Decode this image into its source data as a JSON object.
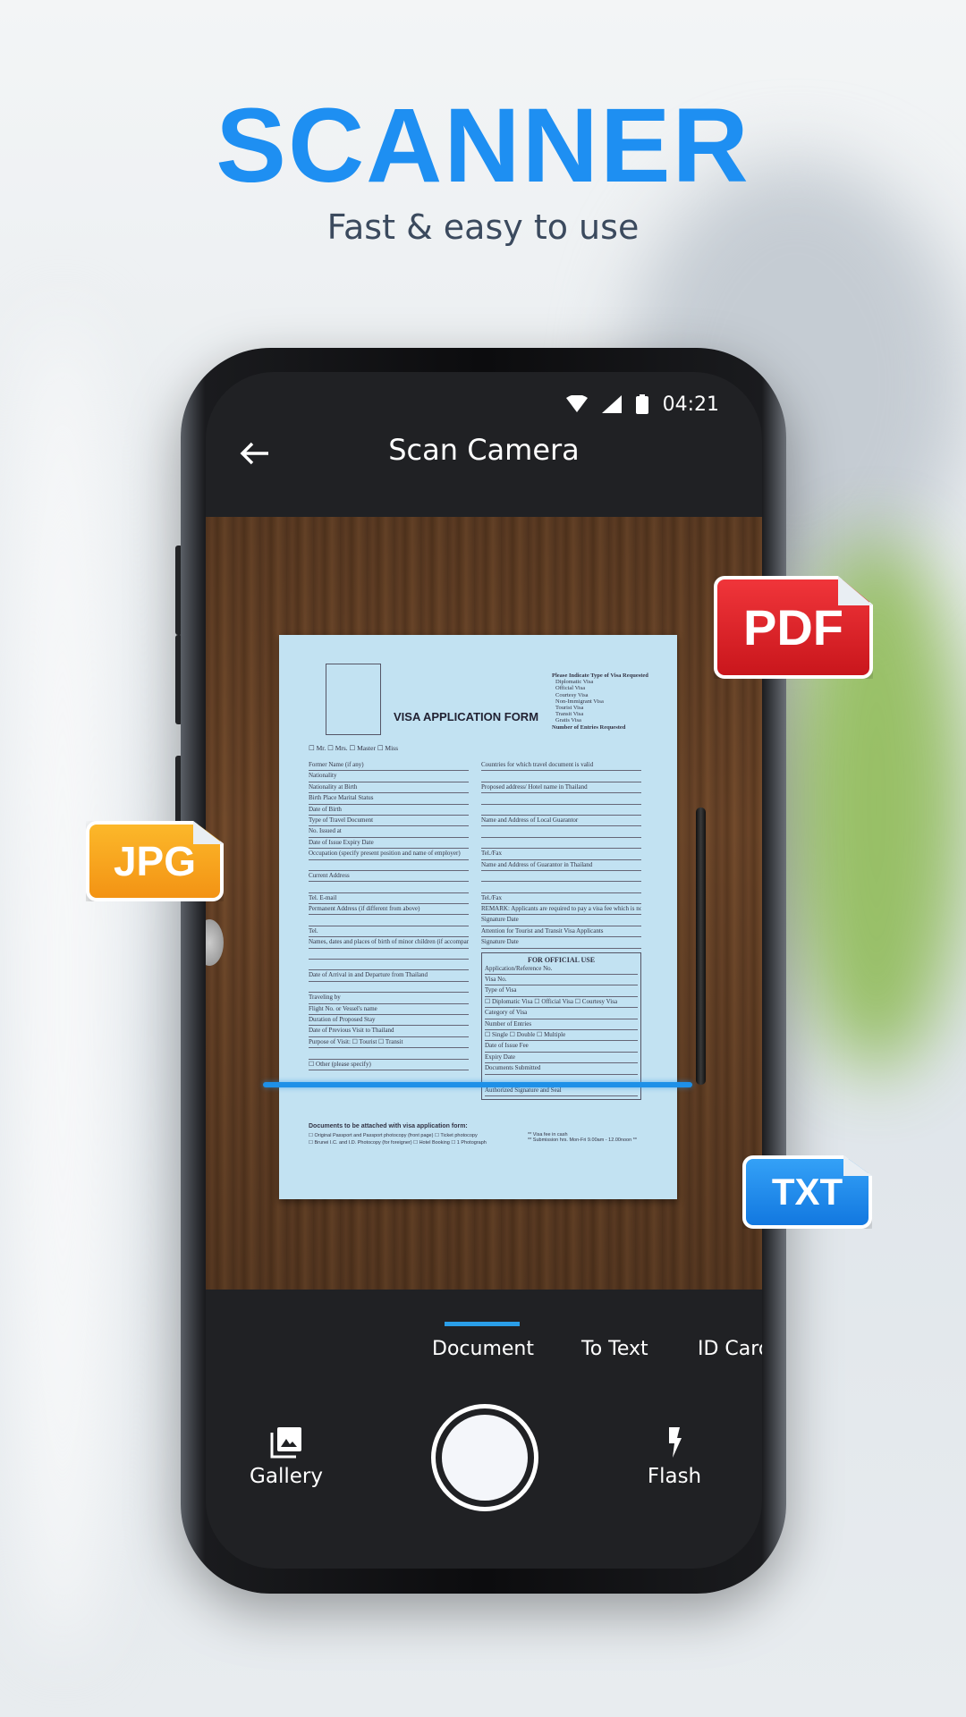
{
  "promo": {
    "title": "SCANNER",
    "subtitle": "Fast & easy to use"
  },
  "status_bar": {
    "time": "04:21",
    "icons": [
      "wifi-icon",
      "signal-icon",
      "battery-icon"
    ]
  },
  "header": {
    "title": "Scan Camera",
    "back_icon": "arrow-left-icon"
  },
  "document": {
    "title": "VISA APPLICATION FORM",
    "visa_types_heading": "Please Indicate Type of Visa Requested",
    "visa_types": [
      "Diplomatic Visa",
      "Official Visa",
      "Courtesy Visa",
      "Non-Immigrant Visa",
      "Tourist Visa",
      "Transit Visa",
      "Gratis Visa"
    ],
    "entries": "Number of Entries Requested",
    "salutation": "☐ Mr.  ☐ Mrs.  ☐ Master  ☐ Miss",
    "left_fields": [
      "Former Name (if any)",
      "Nationality",
      "Nationality at Birth",
      "Birth Place            Marital Status",
      "Date of Birth",
      "Type of Travel Document",
      "No.                    Issued at",
      "Date of Issue          Expiry Date",
      "Occupation (specify present position and name of employer)",
      "",
      "Current Address",
      "",
      "Tel.                   E-mail",
      "Permanent Address (if different from above)",
      "",
      "Tel.",
      "Names, dates and places of birth of minor children (if accompanying)",
      "",
      "",
      "Date of Arrival in and Departure from Thailand",
      "",
      "Traveling by",
      "Flight No. or Vessel's name",
      "Duration of Proposed Stay",
      "Date of Previous Visit to Thailand",
      "Purpose of Visit: ☐ Tourist  ☐ Transit",
      "",
      "☐ Other (please specify)"
    ],
    "right_fields": [
      "Countries for which travel document is valid",
      "",
      "Proposed address/ Hotel name in Thailand",
      "",
      "",
      "Name and Address of Local Guarantor",
      "",
      "",
      "Tel./Fax",
      "Name and Address of Guarantor in Thailand",
      "",
      "",
      "Tel./Fax",
      "REMARK: Applicants are required to pay a visa fee which is non-refundable",
      "Signature               Date",
      "Attention for Tourist and Transit Visa Applicants",
      "Signature               Date"
    ],
    "official_heading": "FOR OFFICIAL USE",
    "official_fields": [
      "Application/Reference No.",
      "Visa No.",
      "Type of Visa",
      "☐ Diplomatic Visa ☐ Official Visa ☐ Courtesy Visa",
      "Category of Visa",
      "Number of Entries",
      "☐ Single ☐ Double ☐ Multiple",
      "Date of Issue        Fee",
      "Expiry Date",
      "Documents Submitted",
      "",
      "Authorized Signature and Seal"
    ],
    "attach_heading": "Documents to be attached with visa application form:",
    "attach_items": "☐ Original Passport and Passport photocopy (front page)  ☐ Ticket photocopy",
    "attach_items2": "☐ Brunei I.C. and I.D. Photocopy (for foreigner)  ☐ Hotel Booking  ☐ 1 Photograph",
    "fee_note": "** Visa fee in cash",
    "hours_note": "** Submission hrs. Mon-Fri 9.00am - 12.00noon **"
  },
  "modes": [
    {
      "label": "Document",
      "active": true
    },
    {
      "label": "To Text",
      "active": false
    },
    {
      "label": "ID Card",
      "active": false
    }
  ],
  "controls": {
    "gallery": "Gallery",
    "flash": "Flash"
  },
  "badges": [
    {
      "label": "PDF",
      "color": "#e8262c"
    },
    {
      "label": "JPG",
      "color": "#f7a41d"
    },
    {
      "label": "TXT",
      "color": "#1a8cf0"
    }
  ],
  "colors": {
    "accent": "#1e8ff2",
    "screen_bg": "#202124",
    "scan_line": "#1e90e8"
  }
}
